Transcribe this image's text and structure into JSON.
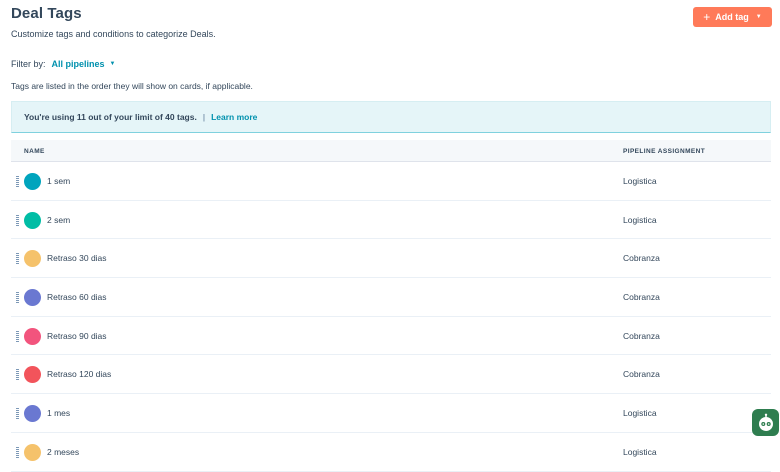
{
  "header": {
    "title": "Deal Tags",
    "subtitle": "Customize tags and conditions to categorize Deals.",
    "add_tag_label": "Add tag"
  },
  "filter": {
    "label": "Filter by:",
    "value": "All pipelines"
  },
  "order_note": "Tags are listed in the order they will show on cards, if applicable.",
  "banner": {
    "usage_text": "You're using 11 out of your limit of 40 tags.",
    "separator": "|",
    "learn_more": "Learn more"
  },
  "table": {
    "columns": {
      "name": "NAME",
      "pipeline": "PIPELINE ASSIGNMENT"
    },
    "rows": [
      {
        "name": "1 sem",
        "pipeline": "Logistica",
        "color": "#00a4bd"
      },
      {
        "name": "2 sem",
        "pipeline": "Logistica",
        "color": "#00bda5"
      },
      {
        "name": "Retraso 30 dias",
        "pipeline": "Cobranza",
        "color": "#f5c26b"
      },
      {
        "name": "Retraso 60 dias",
        "pipeline": "Cobranza",
        "color": "#6a78d1"
      },
      {
        "name": "Retraso 90 dias",
        "pipeline": "Cobranza",
        "color": "#f2547d"
      },
      {
        "name": "Retraso 120 dias",
        "pipeline": "Cobranza",
        "color": "#f2545b"
      },
      {
        "name": "1 mes",
        "pipeline": "Logistica",
        "color": "#6a78d1"
      },
      {
        "name": "2 meses",
        "pipeline": "Logistica",
        "color": "#f5c26b"
      }
    ]
  },
  "colors": {
    "accent": "#ff7a59",
    "link": "#0091ae",
    "text": "#33475b",
    "banner_bg": "#e5f5f8"
  },
  "icons": {
    "add": "plus-icon",
    "dropdown": "chevron-down-icon",
    "drag": "drag-handle-icon",
    "help": "help-widget-icon"
  }
}
